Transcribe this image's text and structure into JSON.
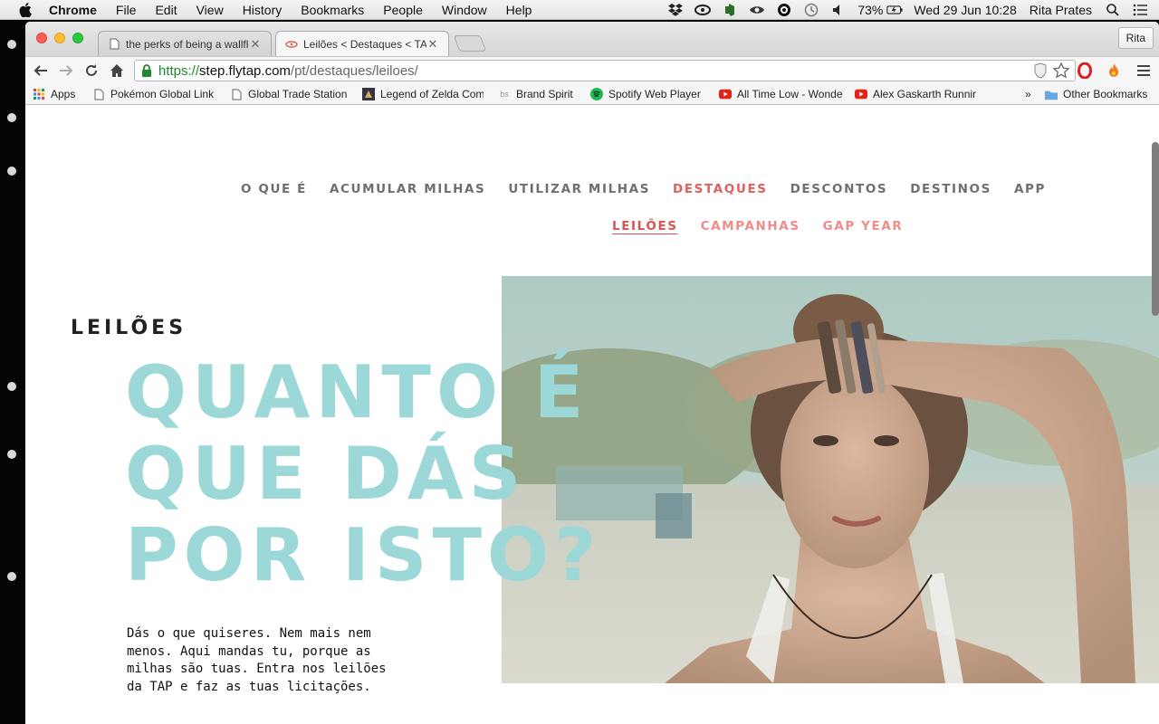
{
  "menubar": {
    "app_name": "Chrome",
    "items": [
      "File",
      "Edit",
      "View",
      "History",
      "Bookmarks",
      "People",
      "Window",
      "Help"
    ],
    "battery": "73%",
    "datetime": "Wed 29 Jun  10:28",
    "user": "Rita Prates",
    "tray_icons": [
      "dropbox-icon",
      "creative-cloud-icon",
      "evernote-icon",
      "eye-icon",
      "at-icon",
      "time-machine-icon",
      "volume-icon",
      "battery-icon",
      "spotlight-icon",
      "notifications-icon"
    ]
  },
  "browser": {
    "tabs": [
      {
        "title": "the perks of being a wallflo",
        "active": false
      },
      {
        "title": "Leilões < Destaques < TAP",
        "active": true
      }
    ],
    "profile": "Rita",
    "url": {
      "scheme": "https://",
      "host": "step.flytap.com",
      "path": "/pt/destaques/leiloes/"
    },
    "bookmarks": [
      {
        "label": "Apps",
        "icon": "apps-grid-icon"
      },
      {
        "label": "Pokémon Global Link",
        "icon": "page-icon"
      },
      {
        "label": "Global Trade Station",
        "icon": "page-icon"
      },
      {
        "label": "Legend of Zelda Com",
        "icon": "zelda-icon"
      },
      {
        "label": "Brand Spirit",
        "icon": "bs-icon"
      },
      {
        "label": "Spotify Web Player",
        "icon": "spotify-icon"
      },
      {
        "label": "All Time Low - Wonde",
        "icon": "youtube-icon"
      },
      {
        "label": "Alex Gaskarth Runnir",
        "icon": "youtube-icon"
      },
      {
        "label": "»",
        "icon": ""
      },
      {
        "label": "Other Bookmarks",
        "icon": "folder-icon"
      }
    ]
  },
  "page": {
    "nav": [
      "O QUE É",
      "ACUMULAR MILHAS",
      "UTILIZAR MILHAS",
      "DESTAQUES",
      "DESCONTOS",
      "DESTINOS",
      "APP"
    ],
    "nav_active": "DESTAQUES",
    "subnav": [
      "LEILÕES",
      "CAMPANHAS",
      "GAP YEAR"
    ],
    "subnav_active": "LEILÕES",
    "section_label": "LEILÕES",
    "headline": [
      "QUANTO É",
      "QUE DÁS",
      "POR ISTO?"
    ],
    "intro": "Dás o que quiseres. Nem mais nem menos. Aqui mandas tu, porque as milhas são tuas. Entra nos leilões da TAP e faz as tuas licitações.",
    "colors": {
      "accent_red": "#e0605b",
      "headline_teal": "#9bd8d7",
      "nav_grey": "#6f6f6f"
    }
  }
}
